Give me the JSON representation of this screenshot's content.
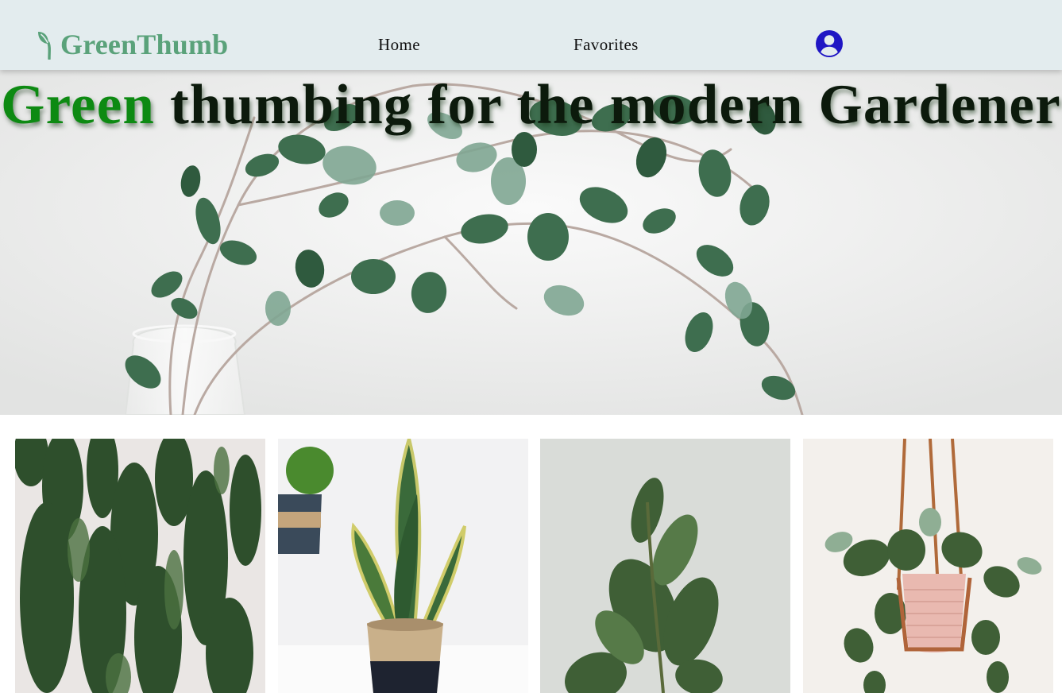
{
  "brand": {
    "name": "GreenThumb",
    "icon": "sprout-icon",
    "color": "#5aa27a"
  },
  "nav": {
    "items": [
      {
        "label": "Home"
      },
      {
        "label": "Favorites"
      }
    ],
    "user_icon": "user-circle-icon",
    "user_icon_color": "#1f16c4"
  },
  "hero": {
    "title_accent": "Green",
    "title_rest": "thumbing for the modern Gardener",
    "accent_color": "#0d8a12",
    "image": "eucalyptus branches in glass vase"
  },
  "cards": [
    {
      "image": "ivy-covered wall"
    },
    {
      "image": "snake plant in woven basket"
    },
    {
      "image": "rubber plant leaves"
    },
    {
      "image": "hanging pothos in pink pot"
    }
  ]
}
